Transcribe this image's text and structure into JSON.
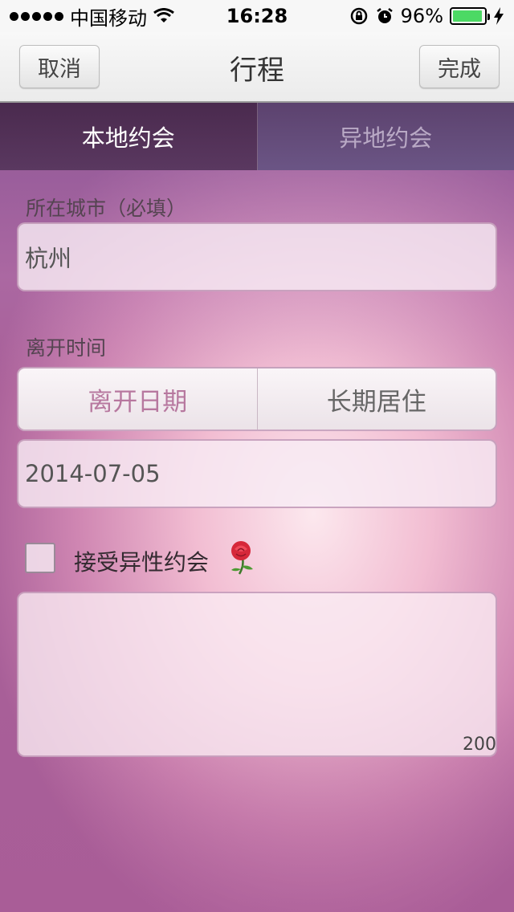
{
  "status_bar": {
    "carrier": "中国移动",
    "time": "16:28",
    "battery_percent": "96%",
    "battery_level": 0.96,
    "battery_color": "#4cd964",
    "icons": [
      "signal-dots-icon",
      "wifi-icon",
      "orientation-lock-icon",
      "alarm-icon",
      "battery-icon",
      "charging-bolt-icon"
    ]
  },
  "nav": {
    "cancel_label": "取消",
    "title": "行程",
    "done_label": "完成"
  },
  "tabs": [
    {
      "label": "本地约会",
      "active": true
    },
    {
      "label": "异地约会",
      "active": false
    }
  ],
  "form": {
    "city_label": "所在城市（必填）",
    "city_value": "杭州",
    "leave_label": "离开时间",
    "segments": [
      {
        "label": "离开日期",
        "active": true
      },
      {
        "label": "长期居住",
        "active": false
      }
    ],
    "date_value": "2014-07-05",
    "accept_label": "接受异性约会",
    "accept_checked": false,
    "accept_icon": "rose-icon",
    "note_value": "",
    "char_counter": "200"
  },
  "colors": {
    "active_tab_bg": "#4a2a4e",
    "segment_active_text": "#b7789f",
    "background_pink": "#f2bdd2"
  }
}
